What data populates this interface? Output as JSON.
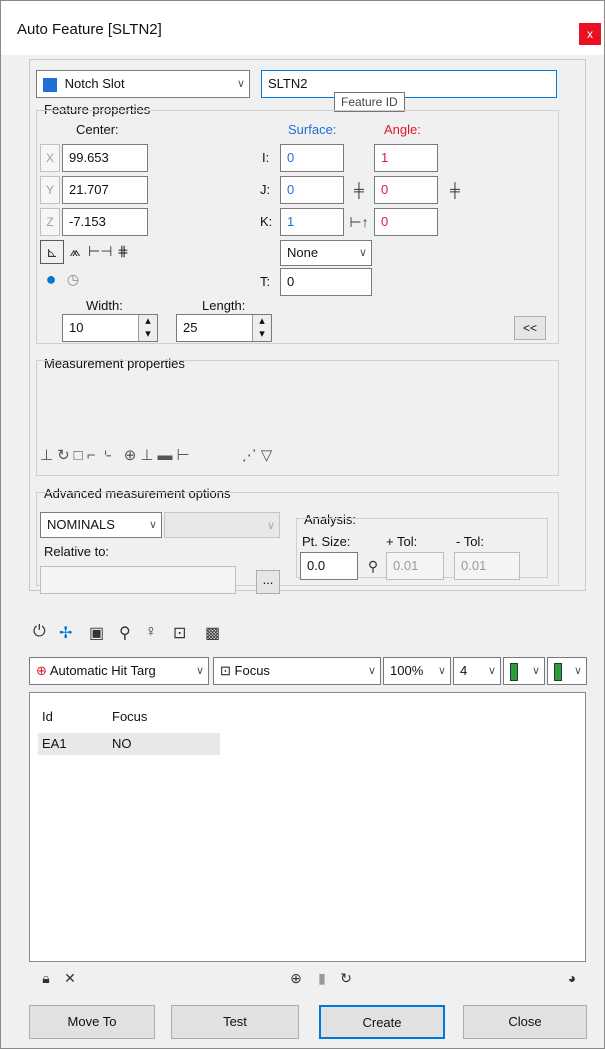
{
  "window": {
    "title": "Auto Feature [SLTN2]",
    "close_label": "x"
  },
  "feature": {
    "type_label": "Notch Slot",
    "id_value": "SLTN2",
    "id_tooltip": "Feature ID",
    "properties_title": "Feature properties",
    "center_label": "Center:",
    "surface_label": "Surface:",
    "angle_label": "Angle:",
    "x_label": "X",
    "y_label": "Y",
    "z_label": "Z",
    "x_value": "99.653",
    "y_value": "21.707",
    "z_value": "-7.153",
    "i_label": "I:",
    "j_label": "J:",
    "k_label": "K:",
    "t_label": "T:",
    "surface_i": "0",
    "surface_j": "0",
    "surface_k": "1",
    "angle_i": "1",
    "angle_j": "0",
    "angle_k": "0",
    "none_label": "None",
    "t_value": "0",
    "width_label": "Width:",
    "width_value": "10",
    "length_label": "Length:",
    "length_value": "25",
    "collapse_label": "<<"
  },
  "measurement": {
    "title": "Measurement properties"
  },
  "advanced": {
    "title": "Advanced measurement options",
    "nominals_label": "NOMINALS",
    "relative_label": "Relative to:",
    "browse_label": "...",
    "analysis_label": "Analysis:",
    "pt_size_label": "Pt. Size:",
    "pt_size_value": "0.0",
    "plus_tol_label": "+ Tol:",
    "plus_tol_value": "0.01",
    "minus_tol_label": "- Tol:",
    "minus_tol_value": "0.01"
  },
  "probe_toolbar": {
    "hit_target_label": "Automatic Hit Targ",
    "focus_label": "Focus",
    "zoom_label": "100%",
    "count_label": "4"
  },
  "table": {
    "headers": [
      "Id",
      "Focus"
    ],
    "rows": [
      [
        "EA1",
        "NO"
      ]
    ]
  },
  "buttons": {
    "move_to": "Move To",
    "test": "Test",
    "create": "Create",
    "close": "Close"
  },
  "colors": {
    "accent": "#0078d7",
    "surface_blue": "#1f6fd6",
    "angle_red": "#e0182d"
  }
}
